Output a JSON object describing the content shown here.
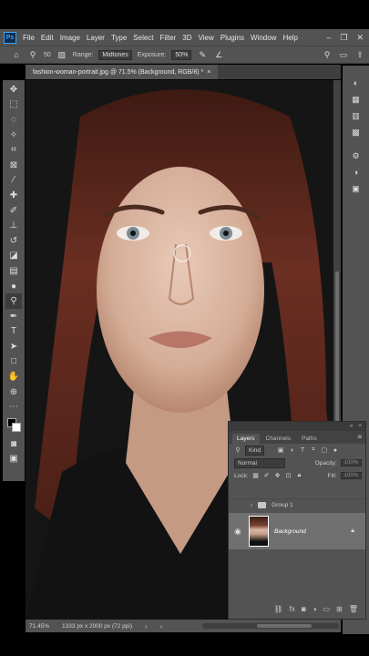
{
  "app": {
    "logo": "Ps"
  },
  "menu": [
    "File",
    "Edit",
    "Image",
    "Layer",
    "Type",
    "Select",
    "Filter",
    "3D",
    "View",
    "Plugins",
    "Window",
    "Help"
  ],
  "window_controls": [
    "–",
    "❐",
    "✕"
  ],
  "options": {
    "brush_size": "50",
    "range_label": "Range:",
    "range_value": "Midtones",
    "exposure_label": "Exposure:",
    "exposure_value": "50%"
  },
  "document": {
    "tab_title": "fashion-woman-portrait.jpg @ 71.5% (Background, RGB/8) *",
    "close": "×"
  },
  "status": {
    "zoom": "71.45%",
    "dimensions": "1333 px x 2000 px (72 ppi)",
    "arrow_left": "‹",
    "arrow_right": "›"
  },
  "layers_panel": {
    "tabs": [
      "Layers",
      "Channels",
      "Paths"
    ],
    "kind_label": "Kind",
    "blend_mode": "Normal",
    "opacity_label": "Opacity:",
    "opacity_value": "100%",
    "lock_label": "Lock:",
    "fill_label": "Fill:",
    "fill_value": "100%",
    "group_name": "Group 1",
    "layer_name": "Background"
  },
  "colors": {
    "chrome": "#535353",
    "panel_dark": "#3c3c3c",
    "selected_layer": "#707070",
    "hair": "#6b2e22",
    "skin": "#d8b5a2"
  }
}
